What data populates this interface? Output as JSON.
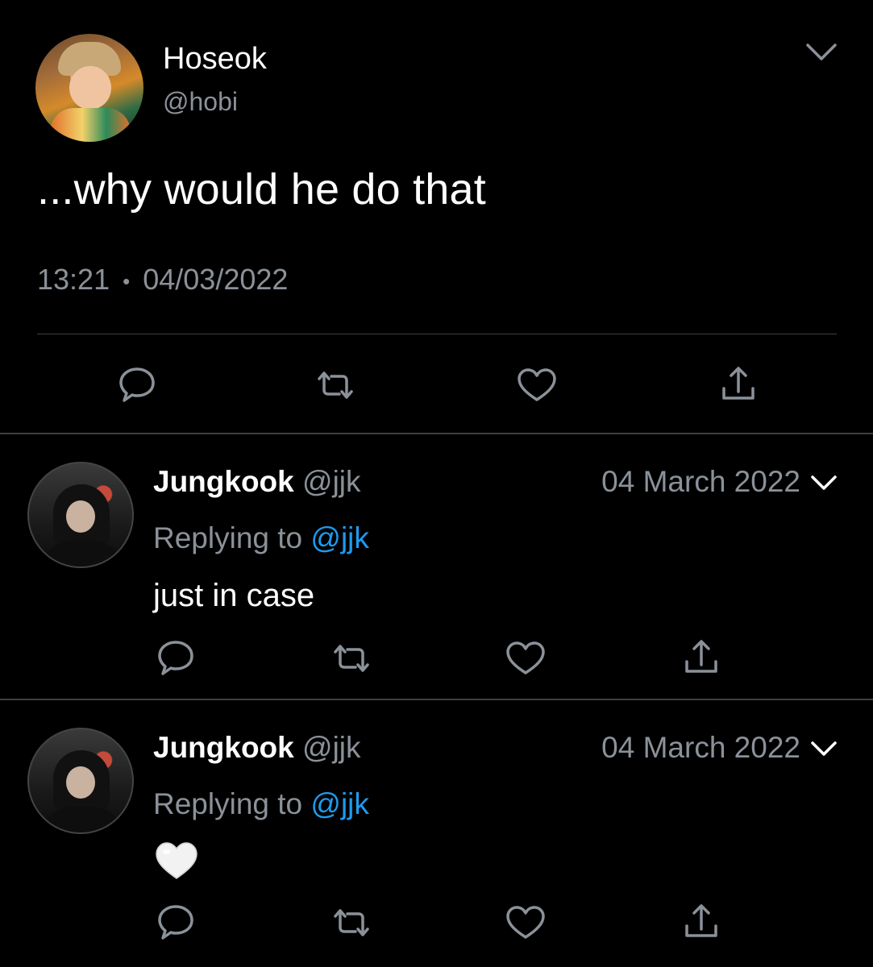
{
  "main_tweet": {
    "name": "Hoseok",
    "handle": "@hobi",
    "text": "...why would he do that",
    "time": "13:21",
    "separator": "•",
    "date": "04/03/2022",
    "avatar_icon": "profile-photo"
  },
  "actions": {
    "reply_icon": "reply-icon",
    "retweet_icon": "retweet-icon",
    "like_icon": "heart-icon",
    "share_icon": "share-icon"
  },
  "replies": [
    {
      "name": "Jungkook",
      "handle": "@jjk",
      "date": "04 March 2022",
      "replying_prefix": "Replying to",
      "replying_to": "@jjk",
      "text": "just in case"
    },
    {
      "name": "Jungkook",
      "handle": "@jjk",
      "date": "04 March 2022",
      "replying_prefix": "Replying to",
      "replying_to": "@jjk",
      "text": "",
      "emoji_icon": "white-heart-emoji"
    }
  ],
  "colors": {
    "background": "#000000",
    "muted_text": "#8b9199",
    "mention": "#1d9bf0",
    "divider": "#3a3f45"
  }
}
